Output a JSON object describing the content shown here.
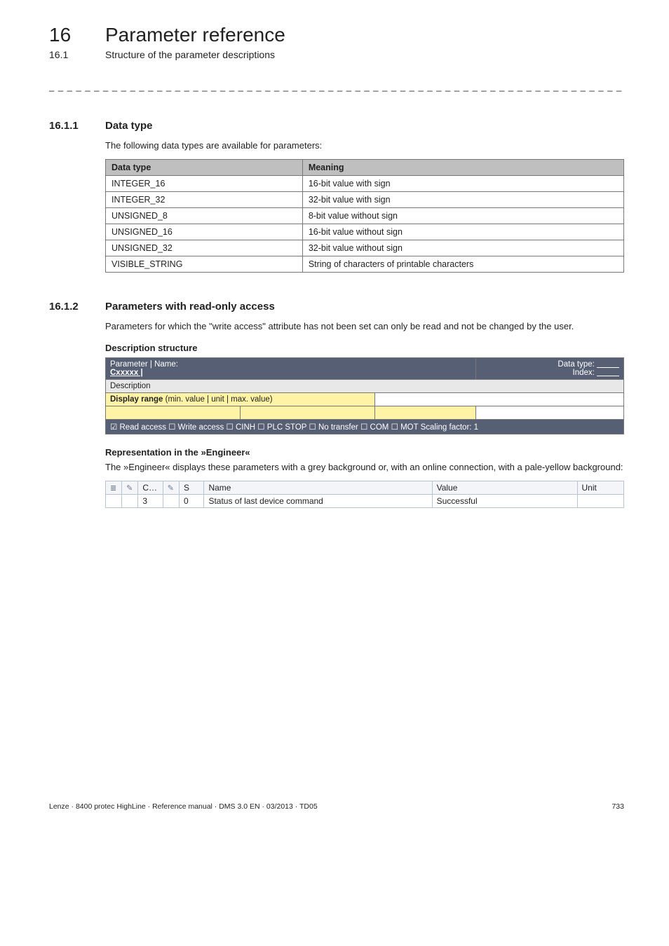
{
  "header": {
    "chapter_num": "16",
    "chapter_title": "Parameter reference",
    "sub_num": "16.1",
    "sub_title": "Structure of the parameter descriptions",
    "dashes": "_ _ _ _ _ _ _ _ _ _ _ _ _ _ _ _ _ _ _ _ _ _ _ _ _ _ _ _ _ _ _ _ _ _ _ _ _ _ _ _ _ _ _ _ _ _ _ _ _ _ _ _ _ _ _ _ _ _ _ _ _ _ _ _"
  },
  "sec1": {
    "num": "16.1.1",
    "title": "Data type",
    "intro": "The following data types are available for parameters:",
    "th1": "Data type",
    "th2": "Meaning",
    "rows": [
      {
        "c1": "INTEGER_16",
        "c2": "16-bit value with sign"
      },
      {
        "c1": "INTEGER_32",
        "c2": "32-bit value with sign"
      },
      {
        "c1": "UNSIGNED_8",
        "c2": "8-bit value without sign"
      },
      {
        "c1": "UNSIGNED_16",
        "c2": "16-bit value without sign"
      },
      {
        "c1": "UNSIGNED_32",
        "c2": "32-bit value without sign"
      },
      {
        "c1": "VISIBLE_STRING",
        "c2": "String of characters of printable characters"
      }
    ]
  },
  "sec2": {
    "num": "16.1.2",
    "title": "Parameters with read-only access",
    "intro": "Parameters for which the \"write access\" attribute has not been set can only be read and not be changed by the user.",
    "desc_struct_label": "Description structure",
    "desc": {
      "param_name": "Parameter | Name:",
      "cxxxxx": "Cxxxxx |",
      "data_type": "Data type:",
      "index": "Index:",
      "description": "Description",
      "display_range": "Display range",
      "display_range_sub": " (min. value | unit | max. value)",
      "attrs": "☑ Read access   ☐ Write access   ☐ CINH   ☐ PLC STOP   ☐ No transfer   ☐ COM   ☐ MOT     Scaling factor: 1"
    },
    "repr_label": "Representation in the »Engineer«",
    "repr_text": "The »Engineer« displays these parameters with a grey background or, with an online connection, with a pale-yellow background:",
    "eng": {
      "h_c": "C…",
      "h_s": "S",
      "h_name": "Name",
      "h_value": "Value",
      "h_unit": "Unit",
      "row": {
        "c": "3",
        "s": "0",
        "name": "Status of last device command",
        "value": "Successful",
        "unit": ""
      }
    }
  },
  "footer": {
    "left": "Lenze · 8400 protec HighLine · Reference manual · DMS 3.0 EN · 03/2013 · TD05",
    "right": "733"
  }
}
